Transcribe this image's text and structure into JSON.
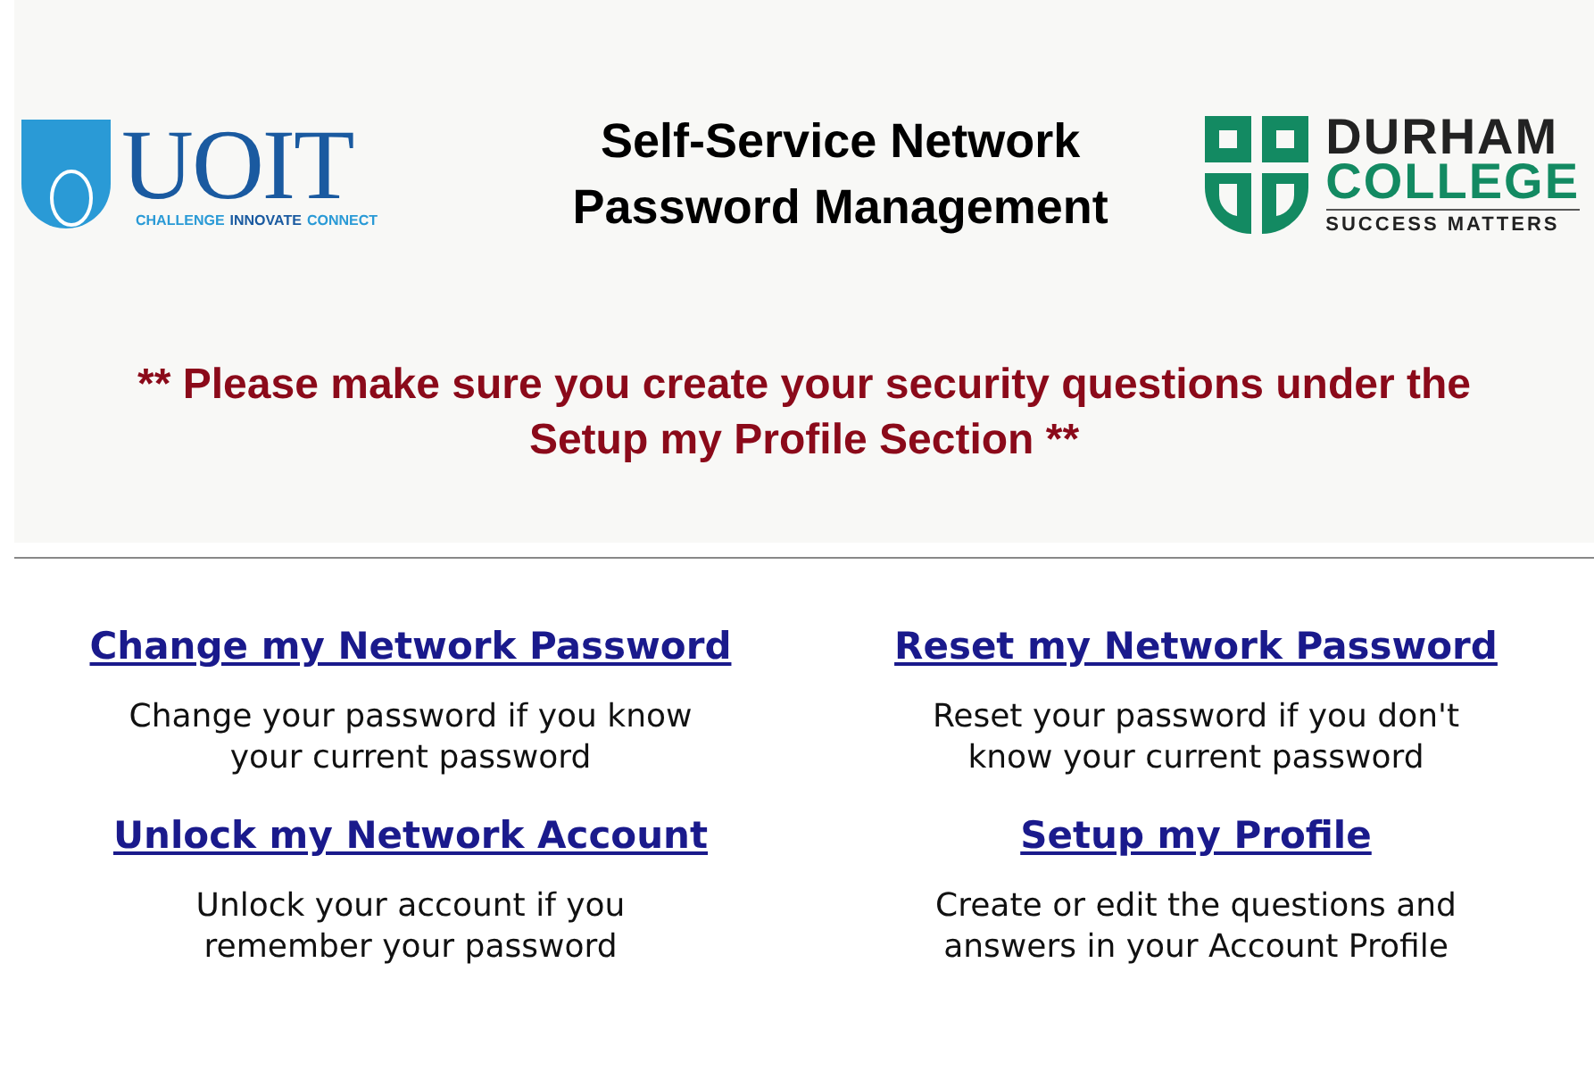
{
  "header": {
    "left_logo": {
      "wordmark": "UOIT",
      "tagline": [
        {
          "text": "CHALLENGE",
          "color": "#2a9ad6"
        },
        {
          "text": "INNOVATE",
          "color": "#1a5aa0"
        },
        {
          "text": "CONNECT",
          "color": "#2a9ad6"
        }
      ]
    },
    "title_lines": [
      "Self-Service Network",
      "Password Management"
    ],
    "right_logo": {
      "name_lines": [
        "DURHAM",
        "COLLEGE"
      ],
      "tagline": "SUCCESS MATTERS"
    },
    "notice": "** Please make sure you create your security questions under the Setup my Profile Section **"
  },
  "options": [
    {
      "link": "Change my Network Password",
      "description": "Change your password if you know your current password"
    },
    {
      "link": "Reset my Network Password",
      "description": "Reset your password if you don't know your current password"
    },
    {
      "link": "Unlock my Network Account",
      "description": "Unlock your account if you remember your password"
    },
    {
      "link": "Setup my Profile",
      "description": "Create or edit the questions and answers in your Account Profile"
    }
  ]
}
